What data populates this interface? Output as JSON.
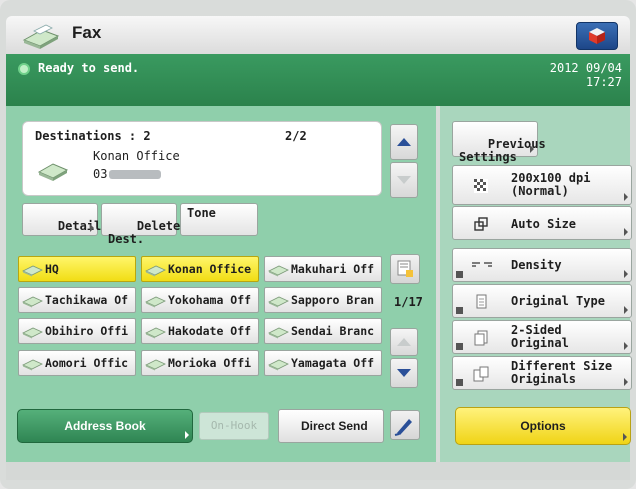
{
  "header": {
    "title": "Fax",
    "icon": "fax-machine-icon",
    "shop_icon": "cube-icon"
  },
  "status": {
    "text": "Ready to send.",
    "date": "2012 09/04",
    "time": "17:27",
    "accent": "#2f8a52"
  },
  "destinations": {
    "label": "Destinations  : 2",
    "page": "2/2",
    "name": "Konan Office",
    "number_prefix": "03"
  },
  "dest_buttons": {
    "details": "Details",
    "delete": "Delete\nDest.",
    "tone": "Tone"
  },
  "speed_dials": [
    {
      "label": "HQ",
      "selected": true
    },
    {
      "label": "Konan Office",
      "selected": true
    },
    {
      "label": "Makuhari Off",
      "selected": false
    },
    {
      "label": "Tachikawa Of",
      "selected": false
    },
    {
      "label": "Yokohama Off",
      "selected": false
    },
    {
      "label": "Sapporo Bran",
      "selected": false
    },
    {
      "label": "Obihiro Offi",
      "selected": false
    },
    {
      "label": "Hakodate Off",
      "selected": false
    },
    {
      "label": "Sendai Branc",
      "selected": false
    },
    {
      "label": "Aomori Offic",
      "selected": false
    },
    {
      "label": "Morioka Offi",
      "selected": false
    },
    {
      "label": "Yamagata Off",
      "selected": false
    }
  ],
  "page_counter": "1/17",
  "bottom": {
    "address_book": "Address Book",
    "on_hook": "On-Hook",
    "direct_send": "Direct Send"
  },
  "right_panel": {
    "previous_settings": "Previous\nSettings",
    "resolution": "200x100 dpi\n(Normal)",
    "size": "Auto Size",
    "density": "Density",
    "original_type": "Original Type",
    "two_sided": "2-Sided\nOriginal",
    "different_size": "Different Size\nOriginals",
    "options": "Options"
  },
  "colors": {
    "selected_yellow": "#f5e431",
    "panel_green": "#8fcfab",
    "status_green": "#2f8a52"
  }
}
